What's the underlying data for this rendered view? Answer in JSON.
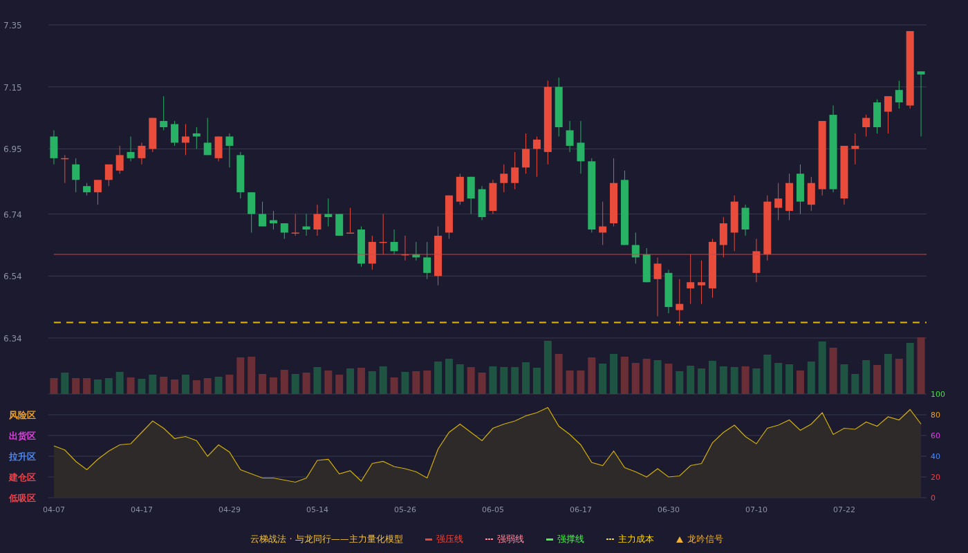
{
  "price_chart": {
    "chart_data": {
      "type": "candlestick",
      "grid": true,
      "ylim": [
        6.34,
        7.35
      ],
      "yticks": [
        {
          "value": 7.35,
          "label": "7.35"
        },
        {
          "value": 7.15,
          "label": "7.15"
        },
        {
          "value": 6.95,
          "label": "6.95"
        },
        {
          "value": 6.74,
          "label": "6.74"
        },
        {
          "value": 6.54,
          "label": "6.54"
        },
        {
          "value": 6.34,
          "label": "6.34"
        }
      ],
      "ohlc": [
        [
          6.99,
          7.01,
          6.9,
          6.92
        ],
        [
          6.92,
          6.93,
          6.84,
          6.92
        ],
        [
          6.9,
          6.92,
          6.81,
          6.85
        ],
        [
          6.83,
          6.84,
          6.8,
          6.81
        ],
        [
          6.81,
          6.85,
          6.77,
          6.85
        ],
        [
          6.85,
          6.9,
          6.83,
          6.9
        ],
        [
          6.88,
          6.96,
          6.87,
          6.93
        ],
        [
          6.94,
          6.99,
          6.91,
          6.92
        ],
        [
          6.92,
          6.97,
          6.9,
          6.96
        ],
        [
          6.95,
          7.05,
          6.94,
          7.05
        ],
        [
          7.04,
          7.12,
          7.01,
          7.02
        ],
        [
          7.03,
          7.04,
          6.96,
          6.97
        ],
        [
          6.97,
          7.03,
          6.93,
          6.99
        ],
        [
          7.0,
          7.02,
          6.95,
          6.99
        ],
        [
          6.97,
          7.05,
          6.93,
          6.93
        ],
        [
          6.92,
          6.99,
          6.91,
          6.99
        ],
        [
          6.99,
          7.0,
          6.89,
          6.96
        ],
        [
          6.93,
          6.94,
          6.79,
          6.81
        ],
        [
          6.81,
          6.81,
          6.68,
          6.74
        ],
        [
          6.74,
          6.78,
          6.7,
          6.7
        ],
        [
          6.72,
          6.75,
          6.69,
          6.71
        ],
        [
          6.71,
          6.71,
          6.66,
          6.68
        ],
        [
          6.68,
          6.74,
          6.67,
          6.68
        ],
        [
          6.7,
          6.74,
          6.67,
          6.69
        ],
        [
          6.69,
          6.77,
          6.67,
          6.74
        ],
        [
          6.74,
          6.79,
          6.7,
          6.73
        ],
        [
          6.74,
          6.74,
          6.67,
          6.67
        ],
        [
          6.68,
          6.76,
          6.68,
          6.68
        ],
        [
          6.69,
          6.7,
          6.57,
          6.58
        ],
        [
          6.58,
          6.67,
          6.56,
          6.65
        ],
        [
          6.65,
          6.74,
          6.61,
          6.65
        ],
        [
          6.65,
          6.69,
          6.61,
          6.62
        ],
        [
          6.61,
          6.67,
          6.59,
          6.61
        ],
        [
          6.61,
          6.65,
          6.59,
          6.6
        ],
        [
          6.6,
          6.65,
          6.53,
          6.55
        ],
        [
          6.54,
          6.7,
          6.51,
          6.67
        ],
        [
          6.68,
          6.8,
          6.66,
          6.8
        ],
        [
          6.78,
          6.87,
          6.77,
          6.86
        ],
        [
          6.86,
          6.86,
          6.74,
          6.79
        ],
        [
          6.82,
          6.83,
          6.72,
          6.73
        ],
        [
          6.75,
          6.85,
          6.74,
          6.84
        ],
        [
          6.84,
          6.9,
          6.81,
          6.87
        ],
        [
          6.84,
          6.94,
          6.82,
          6.89
        ],
        [
          6.89,
          7.0,
          6.87,
          6.95
        ],
        [
          6.95,
          6.99,
          6.86,
          6.98
        ],
        [
          6.94,
          7.17,
          6.9,
          7.15
        ],
        [
          7.15,
          7.18,
          6.99,
          7.02
        ],
        [
          7.01,
          7.04,
          6.94,
          6.96
        ],
        [
          6.97,
          7.04,
          6.87,
          6.91
        ],
        [
          6.91,
          6.92,
          6.68,
          6.69
        ],
        [
          6.68,
          6.78,
          6.64,
          6.7
        ],
        [
          6.71,
          6.92,
          6.7,
          6.84
        ],
        [
          6.85,
          6.88,
          6.64,
          6.64
        ],
        [
          6.64,
          6.68,
          6.58,
          6.6
        ],
        [
          6.61,
          6.63,
          6.52,
          6.52
        ],
        [
          6.53,
          6.6,
          6.41,
          6.58
        ],
        [
          6.55,
          6.56,
          6.42,
          6.44
        ],
        [
          6.43,
          6.53,
          6.38,
          6.45
        ],
        [
          6.5,
          6.61,
          6.45,
          6.52
        ],
        [
          6.51,
          6.59,
          6.45,
          6.52
        ],
        [
          6.5,
          6.66,
          6.47,
          6.65
        ],
        [
          6.64,
          6.73,
          6.6,
          6.71
        ],
        [
          6.68,
          6.8,
          6.62,
          6.78
        ],
        [
          6.76,
          6.77,
          6.67,
          6.69
        ],
        [
          6.55,
          6.66,
          6.52,
          6.62
        ],
        [
          6.61,
          6.8,
          6.59,
          6.78
        ],
        [
          6.76,
          6.84,
          6.72,
          6.79
        ],
        [
          6.75,
          6.87,
          6.72,
          6.84
        ],
        [
          6.87,
          6.9,
          6.74,
          6.78
        ],
        [
          6.77,
          6.86,
          6.75,
          6.84
        ],
        [
          6.82,
          7.04,
          6.8,
          7.04
        ],
        [
          7.06,
          7.09,
          6.81,
          6.82
        ],
        [
          6.79,
          6.96,
          6.77,
          6.96
        ],
        [
          6.95,
          7.0,
          6.9,
          6.96
        ],
        [
          7.02,
          7.06,
          6.99,
          7.05
        ],
        [
          7.1,
          7.11,
          7.0,
          7.02
        ],
        [
          7.07,
          7.12,
          7.0,
          7.12
        ],
        [
          7.14,
          7.17,
          7.08,
          7.1
        ],
        [
          7.09,
          7.33,
          7.08,
          7.33
        ],
        [
          7.2,
          7.2,
          6.99,
          7.19
        ]
      ]
    }
  },
  "oscillator": {
    "zones": [
      {
        "label": "风险区",
        "color": "#f0a020"
      },
      {
        "label": "出货区",
        "color": "#e040e0"
      },
      {
        "label": "拉升区",
        "color": "#4a8af0"
      },
      {
        "label": "建仓区",
        "color": "#f04048"
      },
      {
        "label": "低吸区",
        "color": "#f04048"
      }
    ],
    "chart_data": {
      "type": "area",
      "grid": true,
      "categories": [
        "04-07",
        null,
        null,
        null,
        null,
        null,
        null,
        null,
        "04-17",
        null,
        null,
        null,
        null,
        null,
        null,
        null,
        "04-29",
        null,
        null,
        null,
        null,
        null,
        null,
        null,
        "05-14",
        null,
        null,
        null,
        null,
        null,
        null,
        null,
        "05-26",
        null,
        null,
        null,
        null,
        null,
        null,
        null,
        "06-05",
        null,
        null,
        null,
        null,
        null,
        null,
        null,
        "06-17",
        null,
        null,
        null,
        null,
        null,
        null,
        null,
        "06-30",
        null,
        null,
        null,
        null,
        null,
        null,
        null,
        "07-10",
        null,
        null,
        null,
        null,
        null,
        null,
        null,
        "07-22",
        null,
        null,
        null,
        null,
        null,
        null,
        null
      ],
      "ylim": [
        0,
        100
      ],
      "yticks": [
        0,
        20,
        40,
        60,
        80,
        100
      ],
      "series": [
        {
          "color": "#d4b106",
          "values": [
            50,
            46,
            35,
            27,
            37,
            45,
            51,
            52,
            63,
            74,
            67,
            57,
            59,
            55,
            40,
            51,
            44,
            27,
            23,
            19,
            19,
            17,
            15,
            19,
            36,
            37,
            23,
            26,
            16,
            33,
            35,
            30,
            28,
            25,
            19,
            47,
            63,
            71,
            63,
            55,
            67,
            71,
            74,
            79,
            82,
            87,
            69,
            61,
            51,
            34,
            31,
            45,
            29,
            25,
            20,
            28,
            20,
            21,
            31,
            33,
            53,
            63,
            70,
            59,
            52,
            67,
            70,
            75,
            65,
            71,
            82,
            61,
            67,
            66,
            73,
            69,
            78,
            75,
            85,
            71
          ]
        }
      ]
    }
  },
  "legend": {
    "title": "云梯战法 · 与龙同行——主力量化模型",
    "items": [
      {
        "label": "强压线",
        "kind": "solid",
        "color": "#f0443a"
      },
      {
        "label": "强弱线",
        "kind": "dotted",
        "color": "#ff8fa0"
      },
      {
        "label": "强撑线",
        "kind": "solid",
        "color": "#4cf04c"
      },
      {
        "label": "主力成本",
        "kind": "dotted",
        "color": "#ffd700"
      },
      {
        "label": "龙吟信号",
        "kind": "triangle",
        "color": "#f0b030"
      }
    ]
  }
}
